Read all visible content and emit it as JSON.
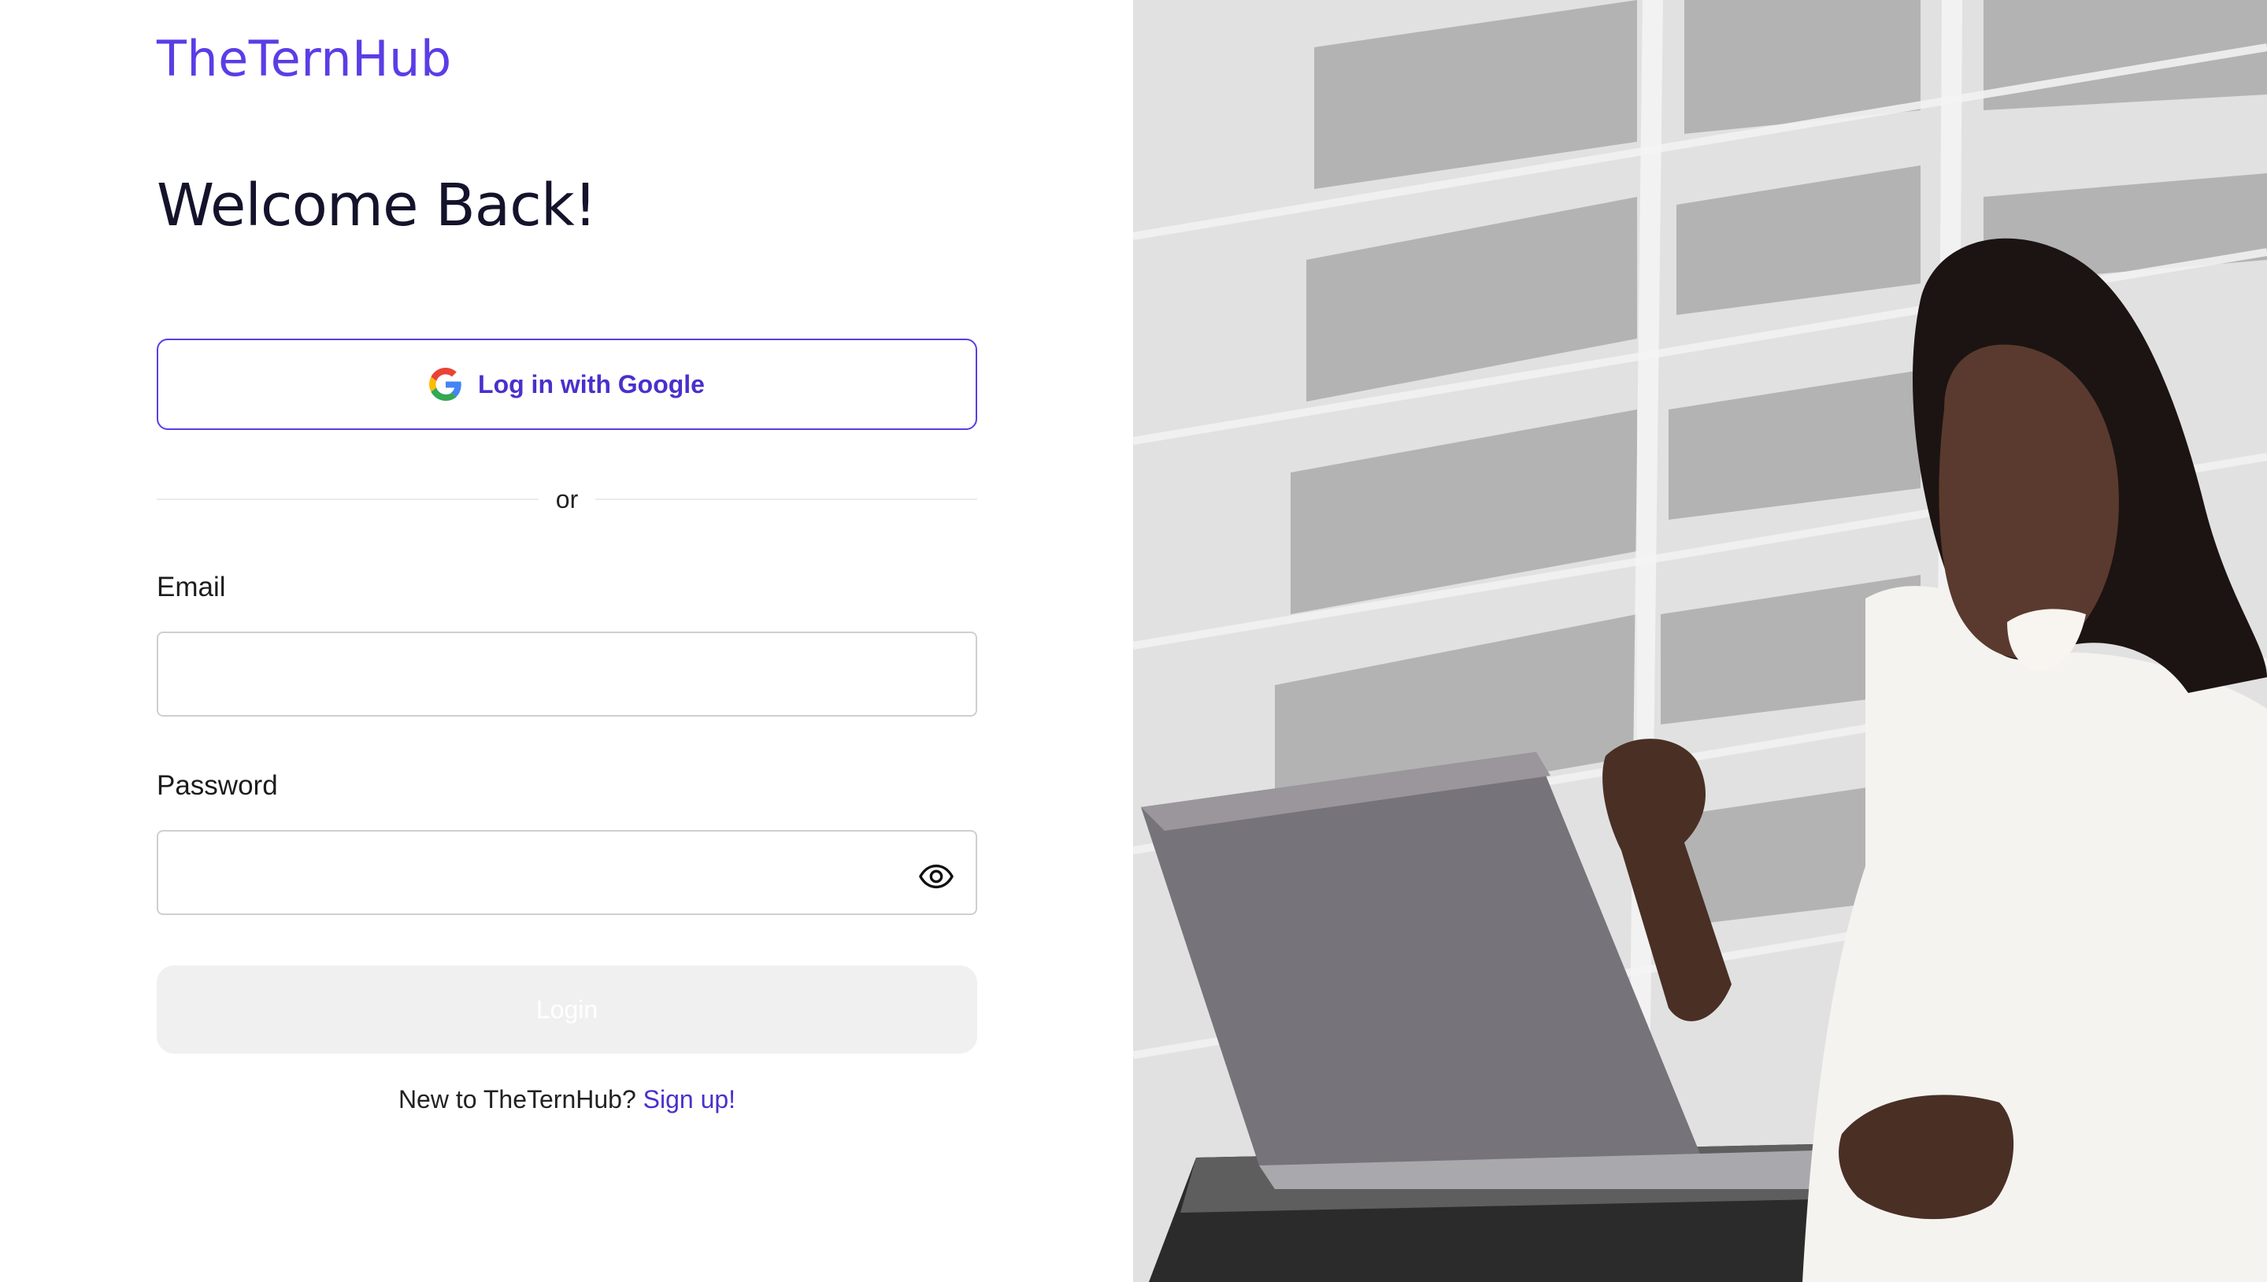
{
  "brand": {
    "name": "TheTernHub",
    "accent_color": "#5b3de6"
  },
  "heading": "Welcome Back!",
  "google_login": {
    "label": "Log in with Google",
    "icon": "google-icon"
  },
  "divider_text": "or",
  "form": {
    "email": {
      "label": "Email",
      "value": "",
      "placeholder": ""
    },
    "password": {
      "label": "Password",
      "value": "",
      "placeholder": "",
      "toggle_icon": "eye-icon"
    },
    "submit_label": "Login"
  },
  "signup": {
    "prompt": "New to TheTernHub?",
    "link_label": "Sign up!"
  },
  "hero_image": {
    "alt": "Smiling woman celebrating while using a laptop in front of an office building"
  }
}
